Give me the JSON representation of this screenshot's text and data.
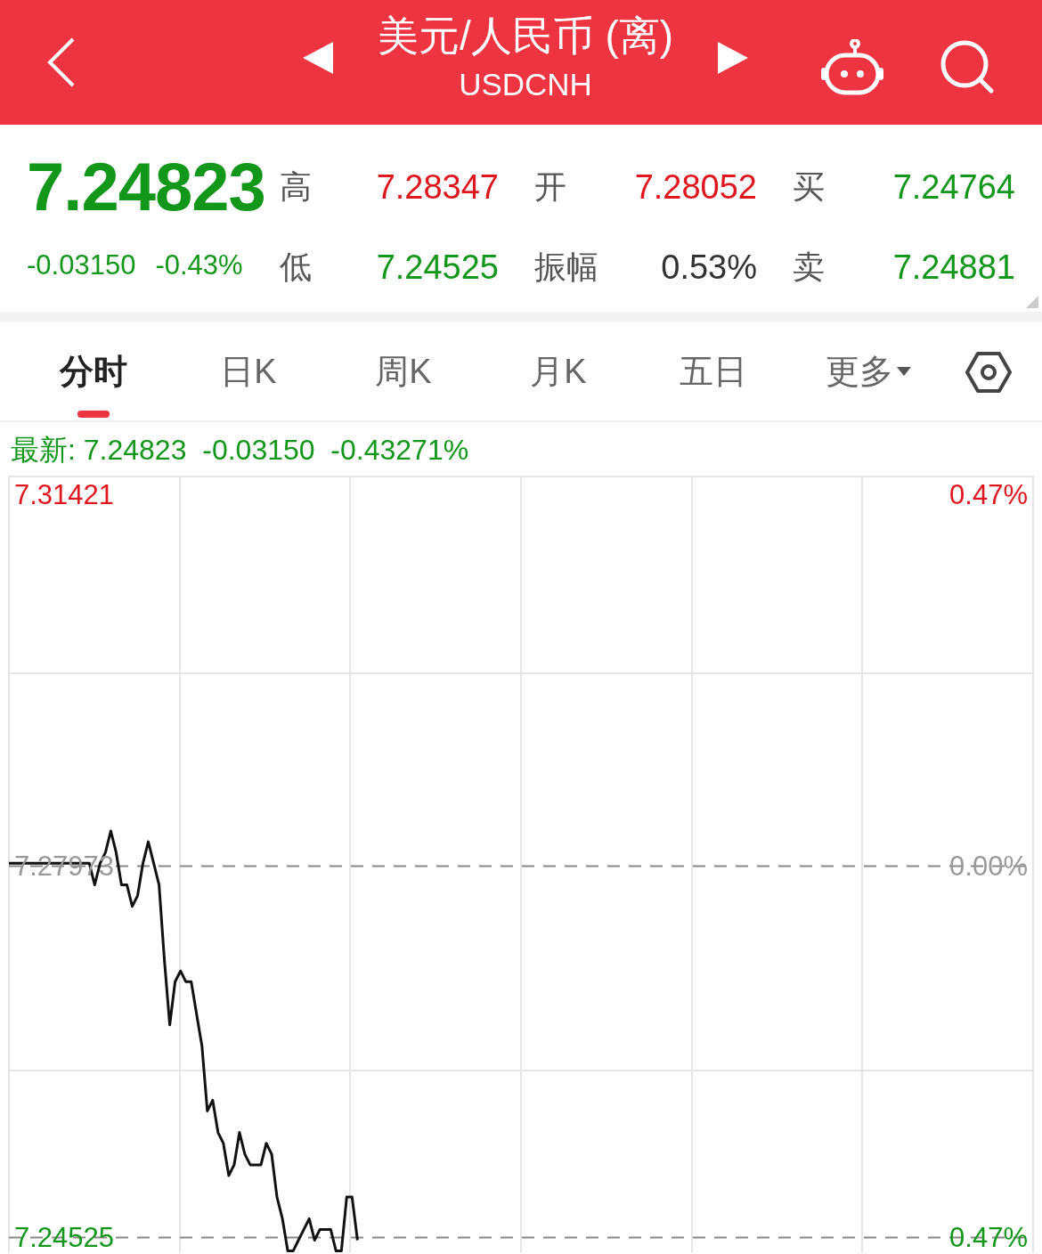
{
  "header": {
    "title": "美元/人民币 (离)",
    "symbol": "USDCNH"
  },
  "quote": {
    "price": "7.24823",
    "change": "-0.03150",
    "change_pct": "-0.43%",
    "color": "#12971b"
  },
  "stats": [
    {
      "label": "高",
      "value": "7.28347",
      "color": "#e0161e"
    },
    {
      "label": "开",
      "value": "7.28052",
      "color": "#e0161e"
    },
    {
      "label": "买",
      "value": "7.24764",
      "color": "#12971b"
    },
    {
      "label": "低",
      "value": "7.24525",
      "color": "#12971b"
    },
    {
      "label": "振幅",
      "value": "0.53%",
      "color": "#333333"
    },
    {
      "label": "卖",
      "value": "7.24881",
      "color": "#12971b"
    }
  ],
  "tabs": [
    {
      "label": "分时",
      "selected": true,
      "kind": "tab"
    },
    {
      "label": "日K",
      "selected": false,
      "kind": "tab"
    },
    {
      "label": "周K",
      "selected": false,
      "kind": "tab"
    },
    {
      "label": "月K",
      "selected": false,
      "kind": "tab"
    },
    {
      "label": "五日",
      "selected": false,
      "kind": "tab"
    },
    {
      "label": "更多",
      "selected": false,
      "kind": "dropdown"
    }
  ],
  "latest": {
    "label": "最新:",
    "price": "7.24823",
    "change": "-0.03150",
    "change_pct": "-0.43271%"
  },
  "chart": {
    "left_labels": [
      {
        "color": "#12971b"
      },
      {
        "color": "#999999"
      },
      {
        "color": "#e0161e"
      }
    ],
    "right_labels": [
      {
        "text": "0.47%",
        "color": "#e0161e"
      },
      {
        "text": "0.00%",
        "color": "#999999"
      },
      {
        "text": "0.47%",
        "color": "#12971b"
      }
    ],
    "chart_data": {
      "type": "line",
      "ylim": [
        7.2438,
        7.316
      ],
      "yticks": [
        {
          "value": 7.24525,
          "label": "7.24525"
        },
        {
          "value": 7.27973,
          "label": "7.27973"
        },
        {
          "value": 7.31421,
          "label": "7.31421"
        }
      ],
      "series": [
        {
          "color": "#111111",
          "values": [
            7.28,
            7.28,
            7.28,
            7.28,
            7.28,
            7.28,
            7.28,
            7.28,
            7.28,
            7.28,
            7.28,
            7.28,
            7.28,
            7.28,
            7.28,
            7.28,
            7.278,
            7.28,
            7.281,
            7.283,
            7.281,
            7.278,
            7.278,
            7.276,
            7.277,
            7.28,
            7.282,
            7.28,
            7.278,
            7.271,
            7.265,
            7.269,
            7.27,
            7.269,
            7.269,
            7.266,
            7.263,
            7.257,
            7.258,
            7.255,
            7.254,
            7.251,
            7.252,
            7.255,
            7.253,
            7.252,
            7.252,
            7.252,
            7.254,
            7.253,
            7.249,
            7.247,
            7.244,
            7.244,
            7.245,
            7.246,
            7.247,
            7.245,
            7.246,
            7.246,
            7.246,
            7.244,
            7.244,
            7.249,
            7.249,
            7.245,
            null,
            null,
            null,
            null,
            null,
            null,
            null,
            null,
            null,
            null,
            null,
            null,
            null,
            null,
            null,
            null,
            null,
            null,
            null,
            null,
            null,
            null,
            null,
            null,
            null,
            null,
            null,
            null,
            null,
            null,
            null,
            null,
            null,
            null,
            null,
            null,
            null,
            null,
            null,
            null,
            null,
            null,
            null,
            null,
            null,
            null,
            null,
            null,
            null,
            null,
            null,
            null,
            null,
            null,
            null,
            null,
            null,
            null,
            null,
            null,
            null,
            null,
            null,
            null,
            null,
            null,
            null,
            null,
            null,
            null,
            null,
            null,
            null,
            null,
            null,
            null,
            null,
            null,
            null,
            null,
            null,
            null,
            null,
            null,
            null,
            null,
            null,
            null,
            null,
            null,
            null,
            null,
            null,
            null,
            null,
            null,
            null,
            null,
            null,
            null,
            null,
            null,
            null,
            null,
            null,
            null,
            null,
            null,
            null,
            null,
            null,
            null,
            null,
            null,
            null,
            null,
            null,
            null,
            null,
            null,
            null,
            null,
            null,
            null,
            null,
            null
          ]
        }
      ]
    }
  }
}
